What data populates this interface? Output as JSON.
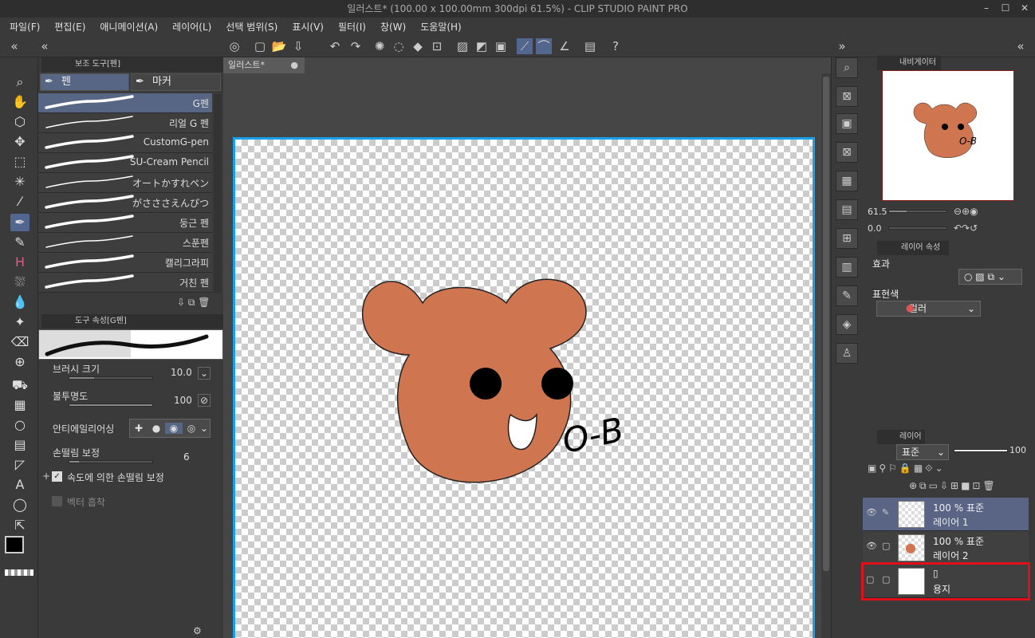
{
  "window": {
    "title": "일러스트* (100.00 x 100.00mm 300dpi 61.5%)  - CLIP STUDIO PAINT PRO",
    "minimize": "–",
    "maximize": "☐",
    "close": "✕"
  },
  "menu": [
    "파일(F)",
    "편집(E)",
    "애니메이션(A)",
    "레이어(L)",
    "선택 범위(S)",
    "표시(V)",
    "필터(I)",
    "창(W)",
    "도움말(H)"
  ],
  "subtool_panel": {
    "title": "보조 도구[펜]",
    "tabs": [
      "펜",
      "마커"
    ],
    "brushes": [
      "G펜",
      "리얼 G 펜",
      "CustomG-pen",
      "SU-Cream Pencil",
      "オートかすれペン",
      "がさささえんぴつ",
      "둥근 펜",
      "스푼펜",
      "캘리그라피",
      "거친 펜"
    ],
    "selected": "G펜"
  },
  "tool_property": {
    "title": "도구 속성[G펜]",
    "preview_label": "G펜",
    "brush_size_label": "브러시 크기",
    "brush_size_value": "10.0",
    "opacity_label": "불투명도",
    "opacity_value": "100",
    "antialias_label": "안티에일리어싱",
    "stabilization_label": "손떨림 보정",
    "stabilization_value": "6",
    "speed_stabilization_label": "속도에 의한 손떨림 보정",
    "vector_snap_label": "벡터 흡착"
  },
  "document": {
    "tab_label": "일러스트*",
    "signature": "O-B"
  },
  "navigator": {
    "title": "내비게이터",
    "zoom": "61.5",
    "rotation": "0.0"
  },
  "layer_property": {
    "title": "레이어 속성",
    "effect_label": "효과",
    "expression_label": "표현색",
    "expression_value": "컬러"
  },
  "layers_panel": {
    "title": "레이어",
    "blend_mode": "표준",
    "opacity": "100",
    "layers": [
      {
        "mode": "100 % 표준",
        "name": "레이어 1",
        "selected": true
      },
      {
        "mode": "100 % 표준",
        "name": "레이어 2",
        "selected": false
      },
      {
        "mode": "",
        "name": "용지",
        "selected": false
      }
    ]
  },
  "colors": {
    "bear": "#cf7650",
    "canvas_border": "#18a0e8",
    "highlight": "#e0101a",
    "selection": "#576685"
  }
}
